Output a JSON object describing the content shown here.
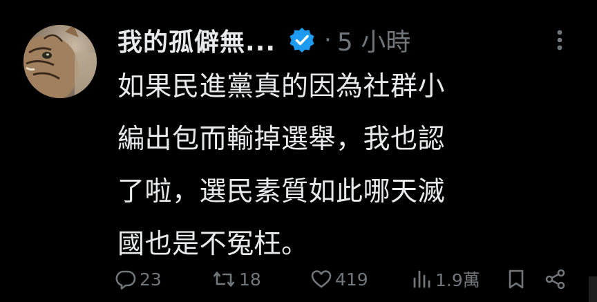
{
  "post": {
    "display_name": "我的孤僻無...",
    "verified": true,
    "separator": "·",
    "timestamp": "5 小時",
    "text_lines": [
      "如果民進黨真的因為社群小",
      "編出包而輸掉選舉，我也認",
      "了啦，選民素質如此哪天滅",
      "國也是不冤枉。"
    ]
  },
  "actions": {
    "reply_count": "23",
    "repost_count": "18",
    "like_count": "419",
    "view_count": "1.9萬"
  },
  "icons": {
    "avatar": "cat-photo-avatar",
    "verified": "verified-badge-icon",
    "more": "more-vertical-icon",
    "reply": "reply-icon",
    "repost": "repost-icon",
    "like": "heart-icon",
    "views": "views-bar-chart-icon",
    "bookmark": "bookmark-icon",
    "share": "share-icon"
  },
  "colors": {
    "background": "#000000",
    "text": "#e7e9ea",
    "muted": "#71767b",
    "verified_blue": "#1d9bf0"
  }
}
